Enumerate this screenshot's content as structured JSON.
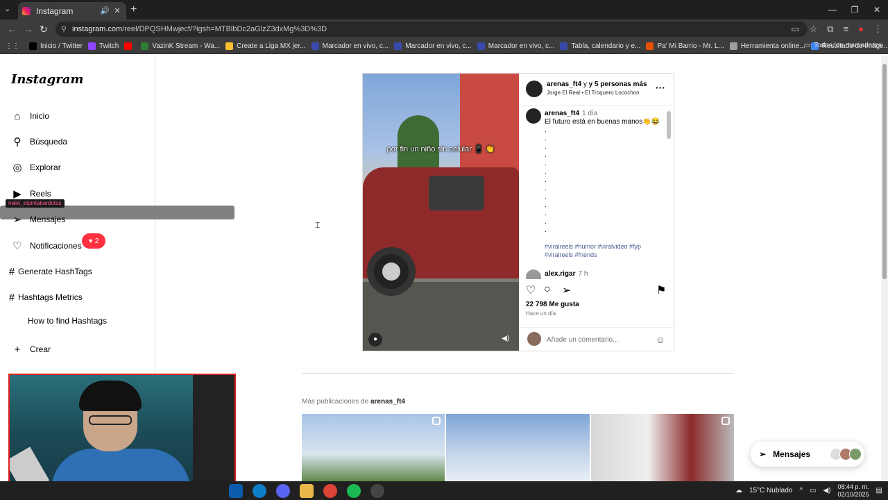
{
  "browser": {
    "tab_title": "Instagram",
    "url_host": "instagram.com",
    "url_path": "/reel/DPQSHMwjecf/?igsh=MTBlbDc2aGlzZ3dxMg%3D%3D",
    "bookmarks": [
      {
        "label": "Inicio / Twitter",
        "color": "#000000"
      },
      {
        "label": "Twitch",
        "color": "#9146ff"
      },
      {
        "label": "",
        "color": "#ff0000"
      },
      {
        "label": "VazinK Stream - Wa...",
        "color": "#2e7d32"
      },
      {
        "label": "Create a Liga MX jer...",
        "color": "#fbc02d"
      },
      {
        "label": "Marcador en vivo, c...",
        "color": "#3949ab"
      },
      {
        "label": "Marcador en vivo, c...",
        "color": "#3949ab"
      },
      {
        "label": "Marcador en vivo, c...",
        "color": "#3949ab"
      },
      {
        "label": "Tabla, calendario y e...",
        "color": "#3949ab"
      },
      {
        "label": "Pa' Mi Barrio - Mr. L...",
        "color": "#e65100"
      },
      {
        "label": "Herramienta online...",
        "color": "#9e9e9e"
      },
      {
        "label": "Resultado de imáge...",
        "color": "#4285f4"
      }
    ],
    "all_bookmarks": "Todos los marcadores"
  },
  "sidebar": {
    "logo": "Instagram",
    "items": [
      {
        "label": "Inicio",
        "icon": "home-icon"
      },
      {
        "label": "Búsqueda",
        "icon": "search-icon"
      },
      {
        "label": "Explorar",
        "icon": "compass-icon"
      },
      {
        "label": "Reels",
        "icon": "reels-icon"
      },
      {
        "label": "Mensajes",
        "icon": "messages-icon"
      },
      {
        "label": "Notificaciones",
        "icon": "heart-icon"
      },
      {
        "label": "Generate HashTags",
        "icon": "hash-icon"
      },
      {
        "label": "Hashtags Metrics",
        "icon": "hash-icon"
      },
      {
        "label": "How to find Hashtags",
        "icon": ""
      },
      {
        "label": "Crear",
        "icon": "plus-icon"
      }
    ],
    "notif_count": "2",
    "overlay_tag": "nako_elpintabardotas"
  },
  "post": {
    "overlay_caption": "por fin un niño sin celular 📱 👏",
    "author": "arenas_ft4",
    "coauthors": "y 5 personas más",
    "audio": "Jorge El Real • El Troquero Locochon",
    "comment_author": "arenas_ft4",
    "comment_time": "1 día",
    "comment_text": "El futuro está en buenas manos👏😂",
    "dots": ".\n.\n.\n.\n.\n.\n.\n.\n.\n.\n.\n.\n.",
    "hashtags": "#viralreels #humor #viralvideo #fyp #viralreels #friends",
    "next_commenter": "alex.rigar",
    "next_time": "7 h",
    "likes": "22 798 Me gusta",
    "posted": "Hace un día",
    "comment_placeholder": "Añade un comentario..."
  },
  "more": {
    "prefix": "Más publicaciones de",
    "author": "arenas_ft4"
  },
  "messages_button": "Mensajes",
  "taskbar": {
    "weather": "15°C Nublado",
    "time": "08:44 p. m.",
    "date": "02/10/2025"
  }
}
